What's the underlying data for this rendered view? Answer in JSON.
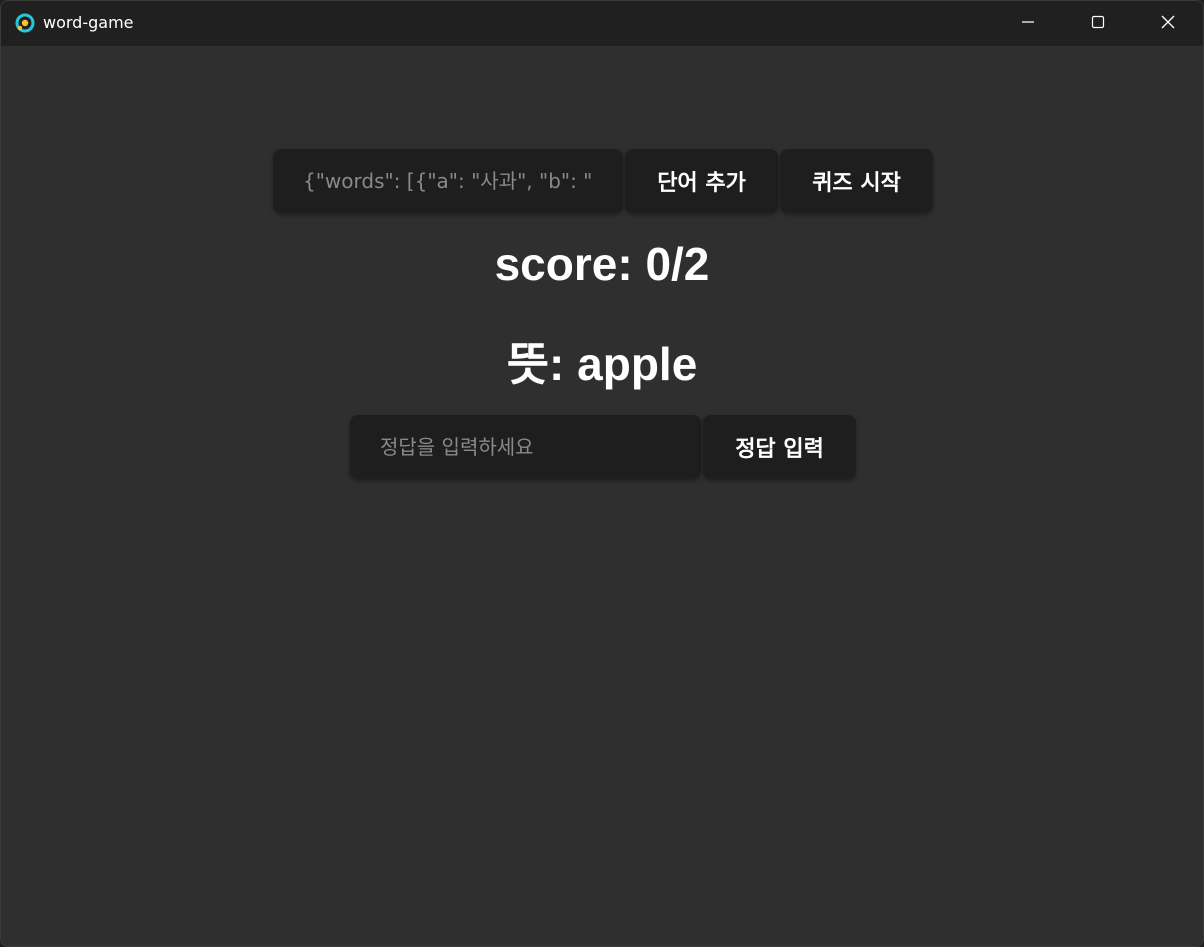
{
  "window": {
    "title": "word-game",
    "app_icon": "app-logo-icon",
    "controls": {
      "minimize_icon": "minimize-icon",
      "maximize_icon": "maximize-icon",
      "close_icon": "close-icon"
    }
  },
  "toolbar": {
    "words_input_placeholder": "{\"words\": [{\"a\": \"사과\", \"b\": \"apple\"}]}",
    "add_words_label": "단어 추가",
    "start_quiz_label": "퀴즈 시작"
  },
  "quiz": {
    "score_text": "score: 0/2",
    "meaning_text": "뜻: apple",
    "answer_placeholder": "정답을 입력하세요",
    "submit_label": "정답 입력"
  },
  "colors": {
    "background": "#2f2f2f",
    "titlebar": "#202020",
    "control_bg": "#1e1e1e",
    "text": "#ffffff"
  }
}
